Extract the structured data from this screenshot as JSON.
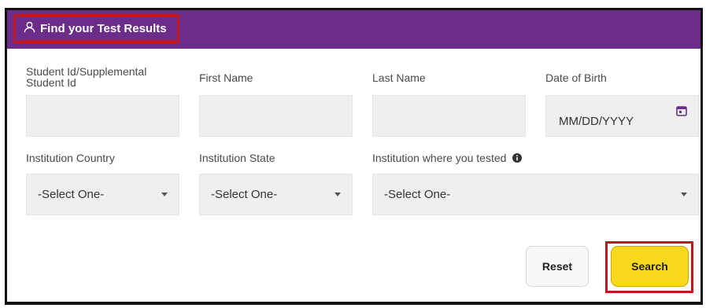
{
  "header": {
    "title": "Find your Test Results",
    "icon": "user-icon",
    "background_color": "#6b2c8a",
    "highlight_color": "#c0161d"
  },
  "fields": {
    "student_id": {
      "label": "Student Id/Supplemental Student Id",
      "value": ""
    },
    "first_name": {
      "label": "First Name",
      "value": ""
    },
    "last_name": {
      "label": "Last Name",
      "value": ""
    },
    "date_of_birth": {
      "label": "Date of Birth",
      "placeholder": "MM/DD/YYYY",
      "icon": "calendar-icon"
    }
  },
  "selects": {
    "institution_country": {
      "label": "Institution Country",
      "selected": "-Select One-"
    },
    "institution_state": {
      "label": "Institution State",
      "selected": "-Select One-"
    },
    "institution_tested": {
      "label": "Institution where you tested",
      "selected": "-Select One-",
      "icon": "info-icon"
    }
  },
  "buttons": {
    "reset_label": "Reset",
    "search_label": "Search",
    "search_color": "#f8d81d"
  }
}
